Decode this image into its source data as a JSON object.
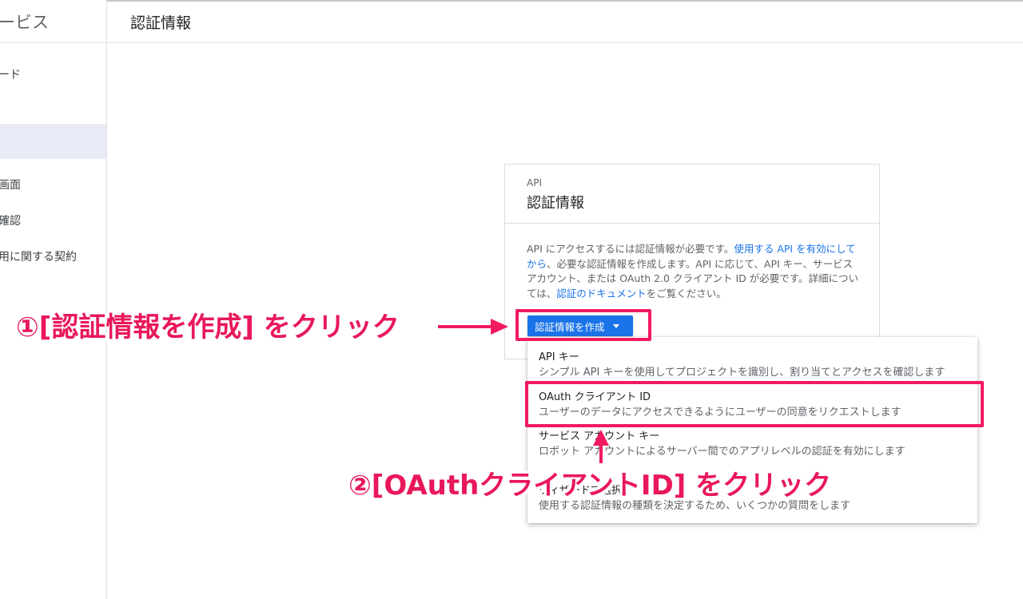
{
  "sidebar": {
    "title": "ービス",
    "items": [
      {
        "label": "ード",
        "active": false
      },
      {
        "label": "",
        "active": true
      },
      {
        "label": "画面",
        "active": false
      },
      {
        "label": "確認",
        "active": false
      },
      {
        "label": "用に関する契約",
        "active": false
      }
    ]
  },
  "header": {
    "title": "認証情報"
  },
  "card": {
    "eyebrow": "API",
    "title": "認証情報",
    "desc_part1": "API にアクセスするには認証情報が必要です。",
    "desc_link1": "使用する API を有効にしてから",
    "desc_part2": "、必要な認証情報を作成します。API に応じて、API キー、サービス アカウント、または OAuth 2.0 クライアント ID が必要です。詳細については、",
    "desc_link2": "認証のドキュメント",
    "desc_part3": "をご覧ください。"
  },
  "create_button": {
    "label": "認証情報を作成"
  },
  "menu": {
    "items": [
      {
        "label": "API キー",
        "desc": "シンプル API キーを使用してプロジェクトを識別し、割り当てとアクセスを確認します"
      },
      {
        "label": "OAuth クライアント ID",
        "desc": "ユーザーのデータにアクセスできるようにユーザーの同意をリクエストします"
      },
      {
        "label": "サービス アカウント キー",
        "desc": "ロボット アカウントによるサーバー間でのアプリレベルの認証を有効にします"
      },
      {
        "label": "ウィザードで選択",
        "desc": "使用する認証情報の種類を決定するため、いくつかの質問をします"
      }
    ]
  },
  "annotations": {
    "step1": "①[認証情報を作成] をクリック",
    "step2": "②[OAuthクライアントID] をクリック",
    "color": "#e8185a"
  },
  "colors": {
    "accent": "#1a73e8",
    "annotation": "#f21a5e",
    "active_bg": "#e8eaf6"
  }
}
